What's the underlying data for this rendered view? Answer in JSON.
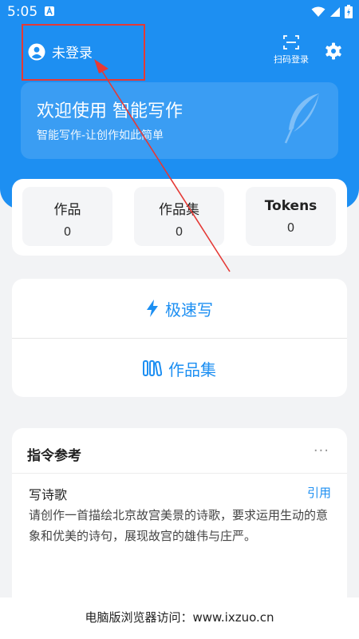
{
  "status_bar": {
    "time": "5:05"
  },
  "header": {
    "login_label": "未登录",
    "scan_label": "扫码登录"
  },
  "welcome": {
    "title": "欢迎使用 智能写作",
    "subtitle": "智能写作-让创作如此简单"
  },
  "stats": [
    {
      "label": "作品",
      "value": "0"
    },
    {
      "label": "作品集",
      "value": "0"
    },
    {
      "label": "Tokens",
      "value": "0"
    }
  ],
  "actions": {
    "fast_write": "极速写",
    "collection": "作品集"
  },
  "reference": {
    "title": "指令参考",
    "more": "···",
    "item_title": "写诗歌",
    "cite_label": "引用",
    "item_body": "请创作一首描绘北京故宫美景的诗歌，要求运用生动的意象和优美的诗句，展现故宫的雄伟与庄严。"
  },
  "footer": {
    "text": "电脑版浏览器访问：www.ixzuo.cn"
  },
  "colors": {
    "primary": "#1d8ff2",
    "annotation": "#e53935",
    "background": "#f2f3f5"
  }
}
